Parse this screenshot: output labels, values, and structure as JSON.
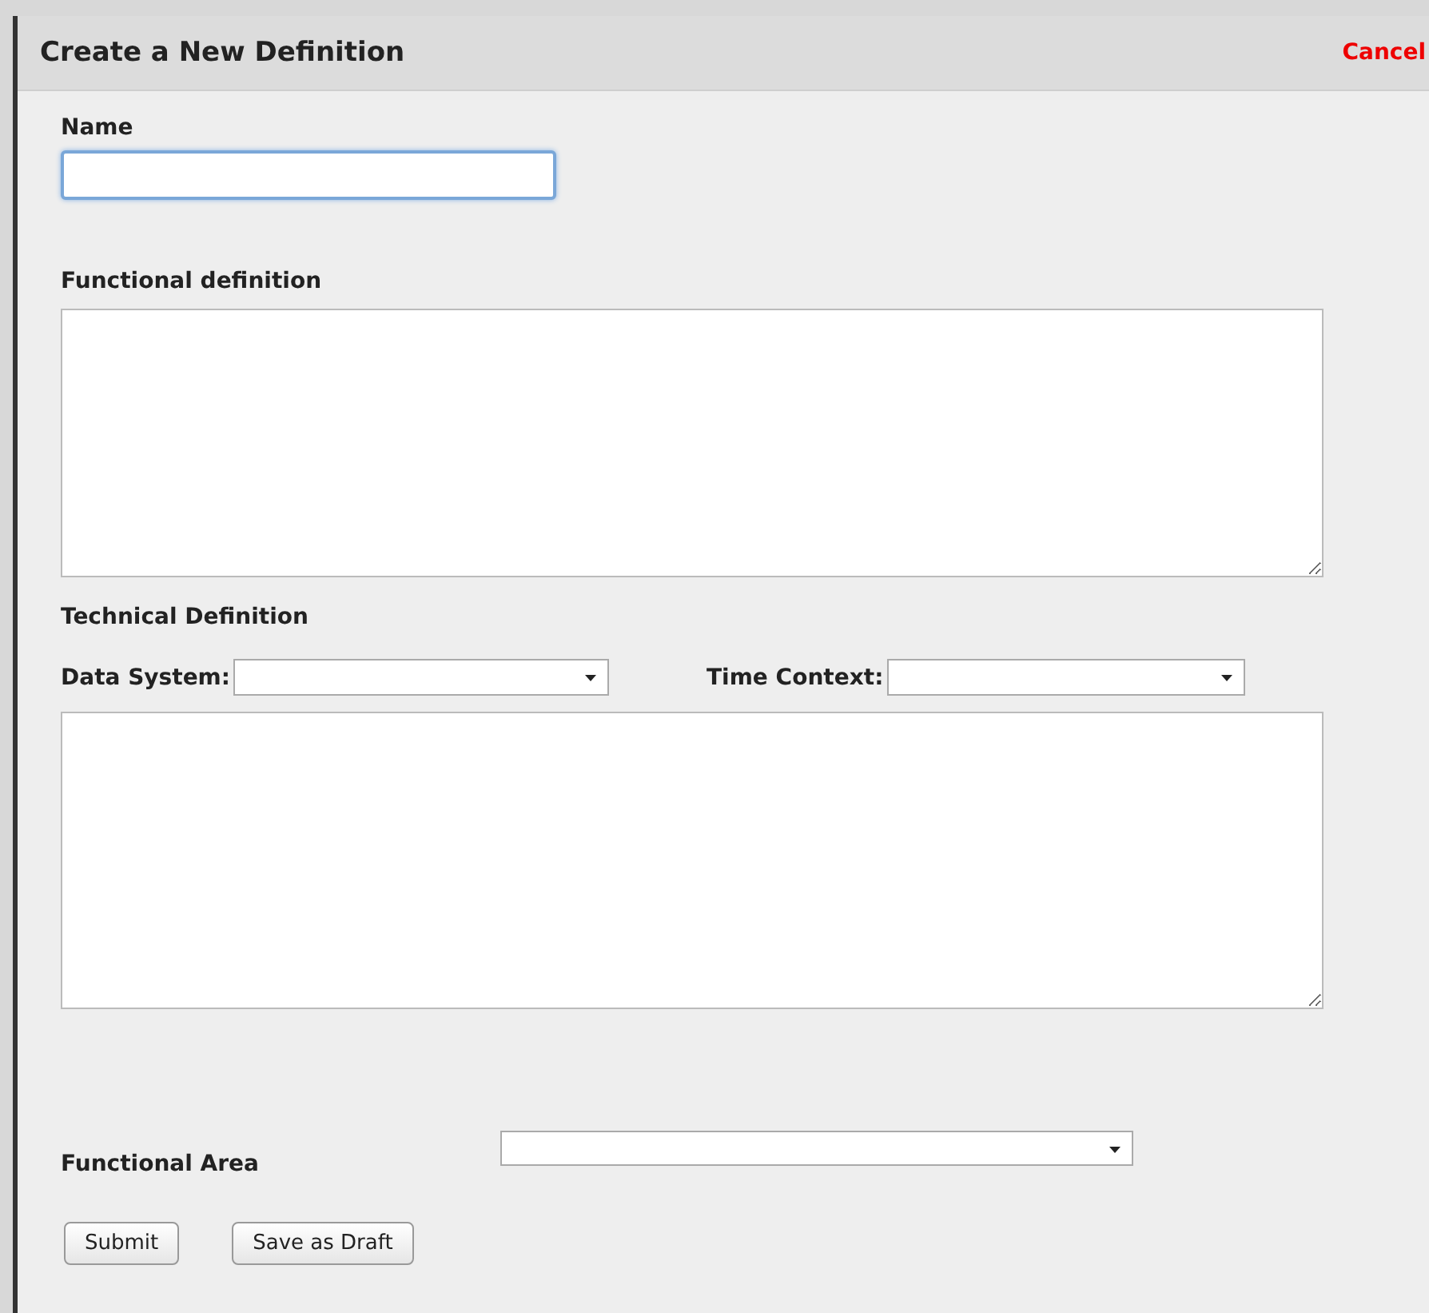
{
  "dialog": {
    "title": "Create a New Definition",
    "cancel": "Cancel"
  },
  "name": {
    "label": "Name",
    "focused": true
  },
  "functional_definition": {
    "label": "Functional definition"
  },
  "technical_definition": {
    "label": "Technical Definition",
    "data_system": {
      "label": "Data System:"
    },
    "time_context": {
      "label": "Time Context:"
    }
  },
  "functional_area": {
    "label": "Functional Area"
  },
  "buttons": [
    "Submit",
    "Save as Draft"
  ]
}
